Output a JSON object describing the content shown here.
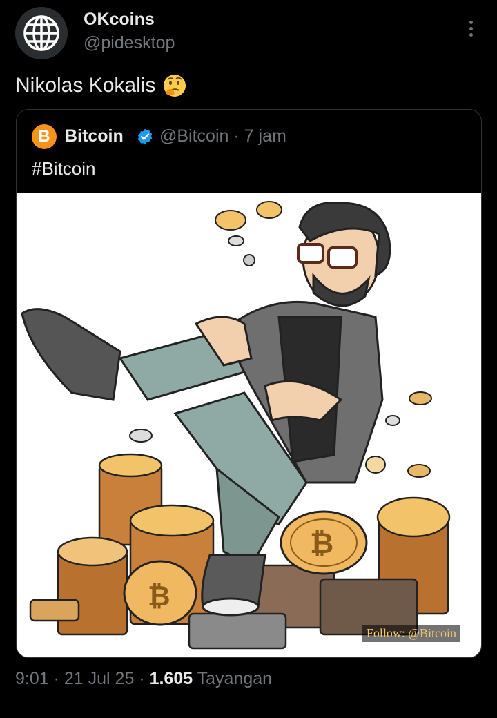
{
  "tweet": {
    "author_name": "OKcoins",
    "author_handle": "@pidesktop",
    "text": "Nikolas Kokalis",
    "emoji_icon": "thinking-face-icon"
  },
  "quoted": {
    "author_name": "Bitcoin",
    "author_handle": "@Bitcoin",
    "separator": "·",
    "time": "7 jam",
    "text": "#Bitcoin",
    "avatar_glyph": "B",
    "avatar_color": "#f7931a",
    "verified_color": "#1d9bf0",
    "image_watermark": "Follow: @Bitcoin"
  },
  "footer": {
    "time": "9:01",
    "sep1": " · ",
    "date": "21 Jul 25",
    "sep2": " · ",
    "views": "1.605",
    "views_label": " Tayangan"
  },
  "colors": {
    "background": "#000000",
    "text": "#e7e9ea",
    "muted": "#71767b",
    "border": "#2f3336"
  }
}
